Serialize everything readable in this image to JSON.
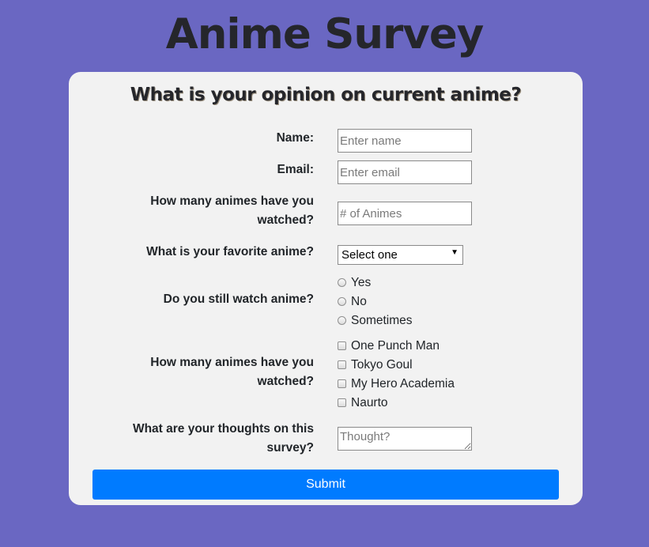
{
  "title": "Anime Survey",
  "card_title": "What is your opinion on current anime?",
  "form": {
    "name_label": "Name:",
    "name_placeholder": "Enter name",
    "email_label": "Email:",
    "email_placeholder": "Enter email",
    "count_label_line1": "How many animes have you",
    "count_label_line2": "watched?",
    "count_placeholder": "# of Animes",
    "favorite_label": "What is your favorite anime?",
    "favorite_selected": "Select one",
    "still_watch_label": "Do you still watch anime?",
    "still_watch_options": [
      "Yes",
      "No",
      "Sometimes"
    ],
    "watched_label_line1": "How many animes have you",
    "watched_label_line2": "watched?",
    "watched_options": [
      "One Punch Man",
      "Tokyo Goul",
      "My Hero Academia",
      "Naurto"
    ],
    "thoughts_label_line1": "What are your thoughts on this",
    "thoughts_label_line2": "survey?",
    "thoughts_placeholder": "Thought?",
    "submit_label": "Submit"
  },
  "colors": {
    "background": "#6a67c2",
    "card": "#f2f2f2",
    "button": "#007bff"
  }
}
